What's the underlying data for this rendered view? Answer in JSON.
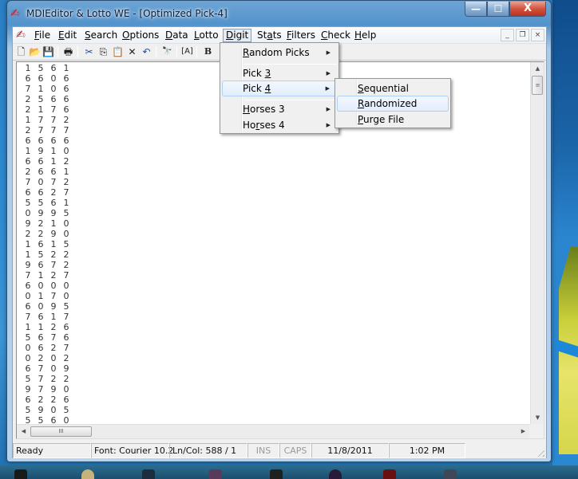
{
  "window": {
    "title": "MDIEditor & Lotto WE - [Optimized Pick-4]",
    "app_icon": "app-logo-icon",
    "caption_buttons": {
      "minimize": "—",
      "maximize": "☐",
      "close": "X"
    }
  },
  "menubar": {
    "items": [
      {
        "label": "File",
        "accel": "F"
      },
      {
        "label": "Edit",
        "accel": "E"
      },
      {
        "label": "Search",
        "accel": "S"
      },
      {
        "label": "Options",
        "accel": "O"
      },
      {
        "label": "Data",
        "accel": "D"
      },
      {
        "label": "Lotto",
        "accel": "L"
      },
      {
        "label": "Digit",
        "accel": "D",
        "open": true
      },
      {
        "label": "Stats",
        "accel": "a"
      },
      {
        "label": "Filters",
        "accel": "F"
      },
      {
        "label": "Check",
        "accel": "C"
      },
      {
        "label": "Help",
        "accel": "H"
      }
    ],
    "mdi_buttons": {
      "minimize": "_",
      "restore": "❐",
      "close": "×"
    }
  },
  "toolbar": {
    "buttons": [
      {
        "name": "new-file-icon",
        "glyph": "🗋"
      },
      {
        "name": "open-folder-icon",
        "glyph": "📂"
      },
      {
        "name": "save-icon",
        "glyph": "💾"
      },
      {
        "name": "print-icon",
        "glyph": "🖶"
      },
      {
        "name": "cut-icon",
        "glyph": "✂"
      },
      {
        "name": "copy-icon",
        "glyph": "⎘"
      },
      {
        "name": "paste-icon",
        "glyph": "📋"
      },
      {
        "name": "delete-icon",
        "glyph": "✕"
      },
      {
        "name": "undo-icon",
        "glyph": "↶"
      },
      {
        "name": "find-icon",
        "glyph": "🔭"
      },
      {
        "name": "font-icon",
        "glyph": "[A]"
      },
      {
        "name": "bold-icon",
        "glyph": "B"
      }
    ]
  },
  "digit_menu": {
    "items": [
      {
        "label": "Random Picks",
        "accel": "R",
        "submenu": true
      },
      {
        "label": "Pick 3",
        "accel": "3",
        "submenu": true
      },
      {
        "label": "Pick 4",
        "accel": "4",
        "submenu": true,
        "highlighted": true
      },
      {
        "label": "Horses 3",
        "accel": "H",
        "submenu": true
      },
      {
        "label": "Horses 4",
        "accel": "r",
        "submenu": true
      }
    ]
  },
  "pick4_submenu": {
    "items": [
      {
        "label": "Sequential",
        "accel": "S"
      },
      {
        "label": "Randomized",
        "accel": "R",
        "highlighted": true
      },
      {
        "label": "Purge File",
        "accel": "P"
      }
    ]
  },
  "editor": {
    "lines": [
      [
        "1",
        "5",
        "6",
        "1"
      ],
      [
        "6",
        "6",
        "0",
        "6"
      ],
      [
        "7",
        "1",
        "0",
        "6"
      ],
      [
        "2",
        "5",
        "6",
        "6"
      ],
      [
        "2",
        "1",
        "7",
        "6"
      ],
      [
        "1",
        "7",
        "7",
        "2"
      ],
      [
        "2",
        "7",
        "7",
        "7"
      ],
      [
        "6",
        "6",
        "6",
        "6"
      ],
      [
        "1",
        "9",
        "1",
        "0"
      ],
      [
        "6",
        "6",
        "1",
        "2"
      ],
      [
        "2",
        "6",
        "6",
        "1"
      ],
      [
        "7",
        "0",
        "7",
        "2"
      ],
      [
        "6",
        "6",
        "2",
        "7"
      ],
      [
        "5",
        "5",
        "6",
        "1"
      ],
      [
        "0",
        "9",
        "9",
        "5"
      ],
      [
        "9",
        "2",
        "1",
        "0"
      ],
      [
        "2",
        "2",
        "9",
        "0"
      ],
      [
        "1",
        "6",
        "1",
        "5"
      ],
      [
        "1",
        "5",
        "2",
        "2"
      ],
      [
        "9",
        "6",
        "7",
        "2"
      ],
      [
        "7",
        "1",
        "2",
        "7"
      ],
      [
        "6",
        "0",
        "0",
        "0"
      ],
      [
        "0",
        "1",
        "7",
        "0"
      ],
      [
        "6",
        "0",
        "9",
        "5"
      ],
      [
        "7",
        "6",
        "1",
        "7"
      ],
      [
        "1",
        "1",
        "2",
        "6"
      ],
      [
        "5",
        "6",
        "7",
        "6"
      ],
      [
        "0",
        "6",
        "2",
        "7"
      ],
      [
        "0",
        "2",
        "0",
        "2"
      ],
      [
        "6",
        "7",
        "0",
        "9"
      ],
      [
        "5",
        "7",
        "2",
        "2"
      ],
      [
        "9",
        "7",
        "9",
        "0"
      ],
      [
        "6",
        "2",
        "2",
        "6"
      ],
      [
        "5",
        "9",
        "0",
        "5"
      ],
      [
        "5",
        "5",
        "6",
        "0"
      ]
    ]
  },
  "statusbar": {
    "status": "Ready",
    "font": "Font: Courier 10.2",
    "position": "Ln/Col: 588 / 1",
    "ins": "INS",
    "caps": "CAPS",
    "date": "11/8/2011",
    "time": "1:02 PM"
  }
}
